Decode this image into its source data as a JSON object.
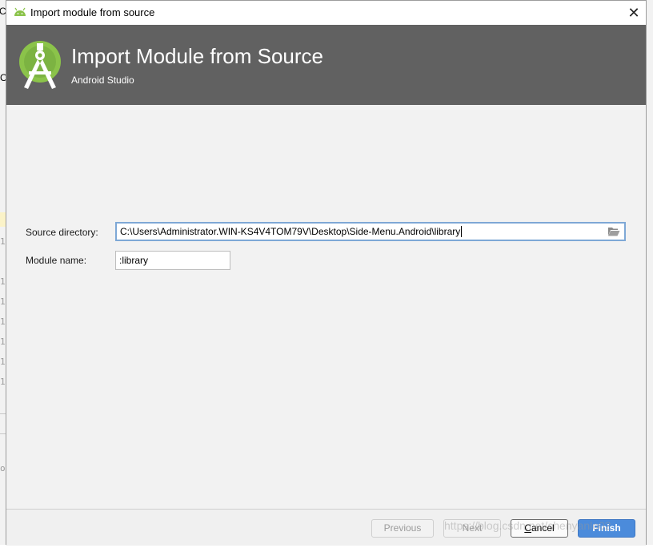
{
  "window": {
    "title": "Import module from source",
    "close_symbol": "✕"
  },
  "header": {
    "title": "Import Module from Source",
    "subtitle": "Android Studio"
  },
  "form": {
    "source_directory_label": "Source directory:",
    "source_directory_value": "C:\\Users\\Administrator.WIN-KS4V4TOM79V\\Desktop\\Side-Menu.Android\\library",
    "module_name_label": "Module name:",
    "module_name_value": ":library"
  },
  "buttons": {
    "previous": "Previous",
    "next": "Next",
    "cancel": "Cancel",
    "finish": "Finish"
  },
  "background_fragments": [
    "CS",
    "C",
    "1",
    "1",
    "1",
    "1",
    "1",
    "1",
    "1",
    "o"
  ],
  "watermark": "https://blog.csdn.net/chenyanlo02",
  "colors": {
    "header_bg": "#616161",
    "android_green": "#8bc34a",
    "primary_button": "#4b8bdb",
    "focus_border": "#7ea8d6"
  }
}
